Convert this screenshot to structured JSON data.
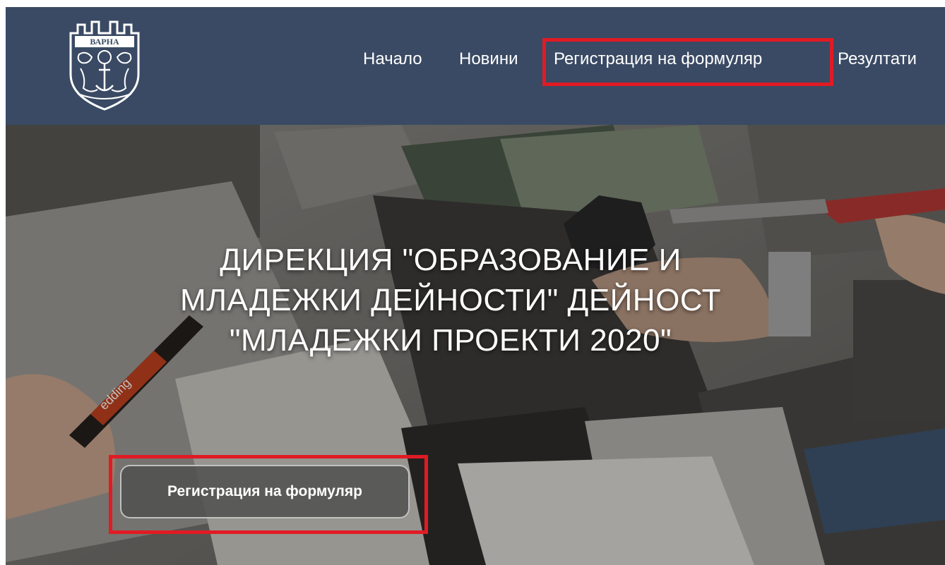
{
  "logo": {
    "text": "ВАРНА",
    "icon": "varna-coat-of-arms-icon"
  },
  "nav": {
    "items": [
      {
        "label": "Начало"
      },
      {
        "label": "Новини"
      },
      {
        "label": "Регистрация на формуляр"
      },
      {
        "label": "Резултати"
      }
    ]
  },
  "hero": {
    "title": "ДИРЕКЦИЯ \"ОБРАЗОВАНИЕ И МЛАДЕЖКИ ДЕЙНОСТИ\" ДЕЙНОСТ \"МЛАДЕЖКИ ПРОЕКТИ 2020\"",
    "cta_label": "Регистрация на формуляр",
    "marker_text": "edding"
  },
  "colors": {
    "navbar": "#3a4a64",
    "highlight": "#e01b24",
    "text": "#ffffff"
  }
}
